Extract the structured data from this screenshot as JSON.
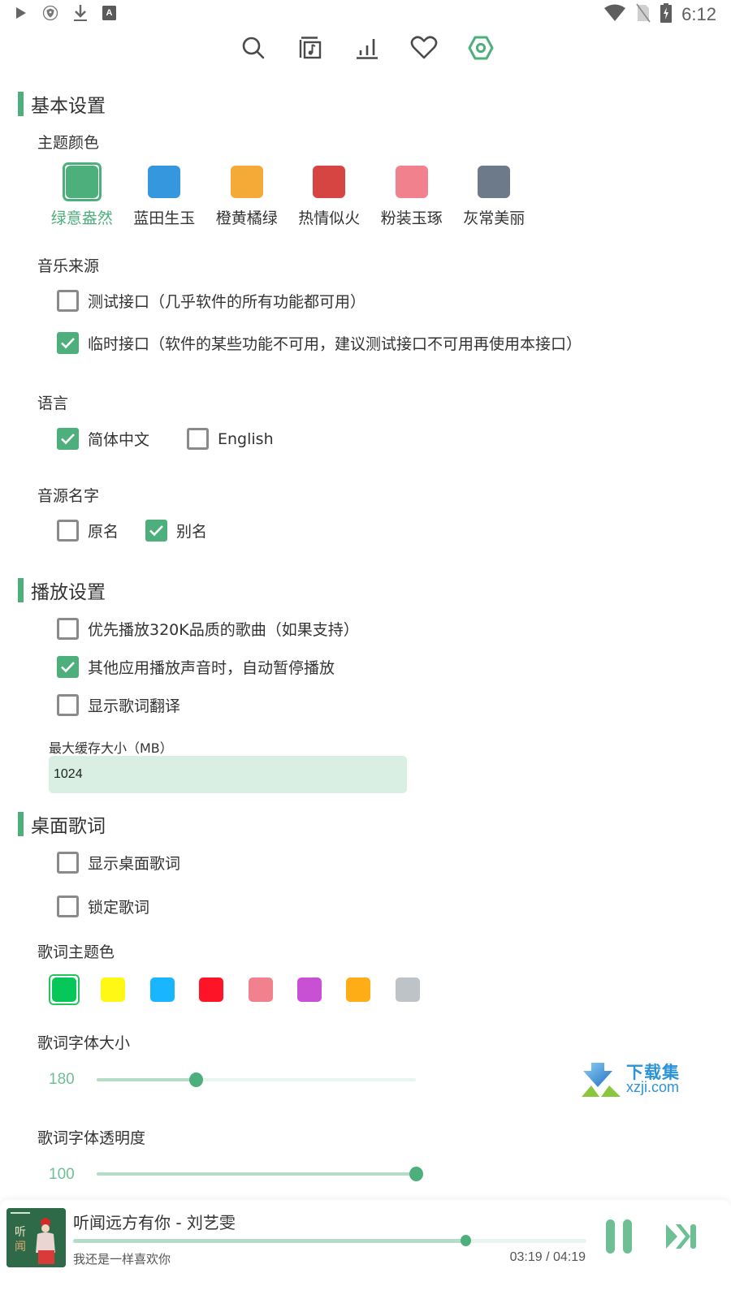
{
  "status_bar": {
    "left_icons": [
      "play-icon",
      "shield-icon",
      "download-icon",
      "font-icon"
    ],
    "right_icons": [
      "wifi-icon",
      "no-sim-icon",
      "battery-charging-icon"
    ],
    "time": "6:12"
  },
  "top_nav": {
    "items": [
      {
        "icon": "search-icon",
        "active": false
      },
      {
        "icon": "music-library-icon",
        "active": false
      },
      {
        "icon": "chart-icon",
        "active": false
      },
      {
        "icon": "heart-icon",
        "active": false
      },
      {
        "icon": "settings-icon",
        "active": true
      }
    ]
  },
  "accent_color": "#4daf7c",
  "basic": {
    "title": "基本设置",
    "theme": {
      "label": "主题颜色",
      "options": [
        {
          "name": "绿意盎然",
          "color": "#4daf7c",
          "selected": true
        },
        {
          "name": "蓝田生玉",
          "color": "#3597dd",
          "selected": false
        },
        {
          "name": "橙黄橘绿",
          "color": "#f5a936",
          "selected": false
        },
        {
          "name": "热情似火",
          "color": "#d64541",
          "selected": false
        },
        {
          "name": "粉装玉琢",
          "color": "#f0818d",
          "selected": false
        },
        {
          "name": "灰常美丽",
          "color": "#6c7a89",
          "selected": false
        }
      ]
    },
    "source": {
      "label": "音乐来源",
      "options": [
        {
          "text": "测试接口（几乎软件的所有功能都可用）",
          "checked": false
        },
        {
          "text": "临时接口（软件的某些功能不可用，建议测试接口不可用再使用本接口）",
          "checked": true
        }
      ]
    },
    "language": {
      "label": "语言",
      "options": [
        {
          "text": "简体中文",
          "checked": true
        },
        {
          "text": "English",
          "checked": false
        }
      ]
    },
    "source_name": {
      "label": "音源名字",
      "options": [
        {
          "text": "原名",
          "checked": false
        },
        {
          "text": "别名",
          "checked": true
        }
      ]
    }
  },
  "playback": {
    "title": "播放设置",
    "options": [
      {
        "text": "优先播放320K品质的歌曲（如果支持）",
        "checked": false
      },
      {
        "text": "其他应用播放声音时，自动暂停播放",
        "checked": true
      },
      {
        "text": "显示歌词翻译",
        "checked": false
      }
    ],
    "cache": {
      "label": "最大缓存大小（MB）",
      "value": "1024"
    }
  },
  "desktop_lyrics": {
    "title": "桌面歌词",
    "options": [
      {
        "text": "显示桌面歌词",
        "checked": false
      },
      {
        "text": "锁定歌词",
        "checked": false
      }
    ],
    "color": {
      "label": "歌词主题色",
      "options": [
        {
          "color": "#07c65a",
          "selected": true
        },
        {
          "color": "#fff714",
          "selected": false
        },
        {
          "color": "#19b5fe",
          "selected": false
        },
        {
          "color": "#fe1427",
          "selected": false
        },
        {
          "color": "#f0818d",
          "selected": false
        },
        {
          "color": "#c851d3",
          "selected": false
        },
        {
          "color": "#fead16",
          "selected": false
        },
        {
          "color": "#bdc3c7",
          "selected": false
        }
      ]
    },
    "font_size": {
      "label": "歌词字体大小",
      "value": "180",
      "fraction": 0.31
    },
    "opacity": {
      "label": "歌词字体透明度",
      "value": "100",
      "fraction": 1.0
    }
  },
  "watermark": {
    "cn": "下载集",
    "en": "xzji.com"
  },
  "player": {
    "title": "听闻远方有你 - 刘艺雯",
    "lyric": "我还是一样喜欢你",
    "time": "03:19 / 04:19",
    "progress": 0.765
  }
}
